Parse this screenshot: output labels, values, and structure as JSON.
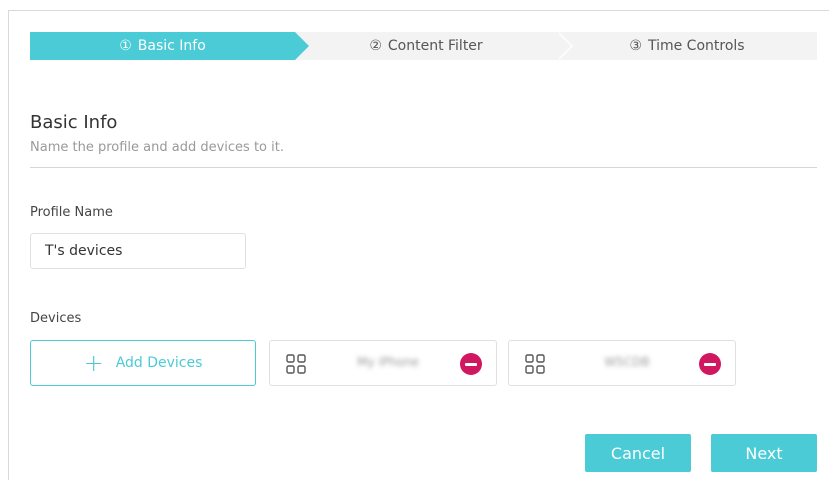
{
  "stepper": {
    "steps": [
      {
        "num": "①",
        "label": "Basic Info"
      },
      {
        "num": "②",
        "label": "Content Filter"
      },
      {
        "num": "③",
        "label": "Time Controls"
      }
    ]
  },
  "section": {
    "title": "Basic Info",
    "subtitle": "Name the profile and add devices to it."
  },
  "profile": {
    "label": "Profile Name",
    "value": "T's devices"
  },
  "devices": {
    "label": "Devices",
    "add_label": "Add Devices",
    "items": [
      {
        "name": "My iPhone"
      },
      {
        "name": "W5CDB"
      }
    ]
  },
  "actions": {
    "cancel_label": "Cancel",
    "next_label": "Next"
  },
  "colors": {
    "accent": "#4acbd6",
    "remove": "#d1175f"
  }
}
